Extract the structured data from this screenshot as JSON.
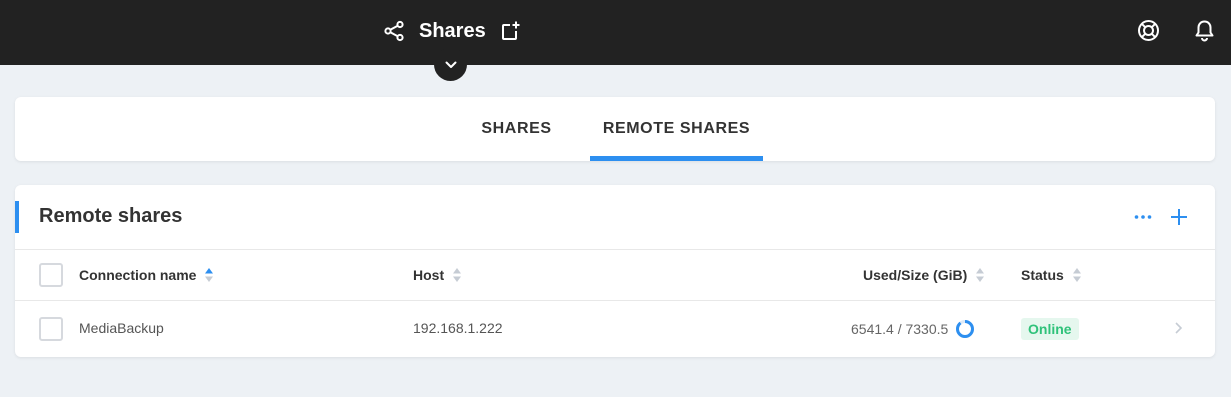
{
  "header": {
    "title": "Shares",
    "icons": {
      "share": "share-icon",
      "new_window": "open-in-new-window-icon",
      "help": "lifebuoy-help-icon",
      "notifications": "bell-icon",
      "collapse": "chevron-down-icon"
    }
  },
  "tabs": [
    {
      "label": "SHARES",
      "active": false
    },
    {
      "label": "REMOTE SHARES",
      "active": true
    }
  ],
  "panel": {
    "title": "Remote shares",
    "icons": {
      "more": "more-horizontal-icon",
      "add": "plus-icon"
    },
    "columns": [
      {
        "label": "Connection name",
        "sort": "ascending"
      },
      {
        "label": "Host",
        "sort": "none"
      },
      {
        "label": "Used/Size (GiB)",
        "sort": "none"
      },
      {
        "label": "Status",
        "sort": "none"
      }
    ],
    "rows": [
      {
        "name": "MediaBackup",
        "host": "192.168.1.222",
        "used_size": "6541.4 / 7330.5",
        "used": 6541.4,
        "size": 7330.5,
        "status": "Online"
      }
    ]
  },
  "colors": {
    "topbar": "#222222",
    "accent": "#2d8ff0",
    "background": "#edf1f5",
    "online_text": "#2fc27a",
    "online_bg": "#e5f7ee",
    "sort_inactive": "#c6ccd4"
  }
}
